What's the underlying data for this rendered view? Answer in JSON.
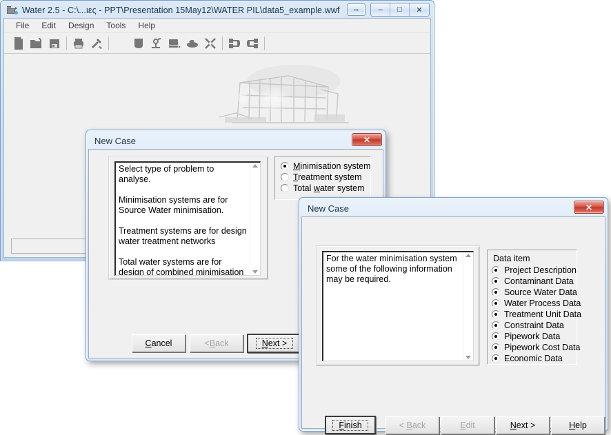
{
  "main_window": {
    "title": "Water 2.5 - C:\\...ιες - PPT\\Presentation 15May12\\WATER PIL\\data5_example.wwf",
    "app_icon_name": "water-app-icon",
    "window_buttons": [
      {
        "name": "restore-size-button",
        "glyph": "⇔"
      },
      {
        "name": "minimize-button",
        "glyph": "–"
      },
      {
        "name": "maximize-button",
        "glyph": "□"
      },
      {
        "name": "close-button",
        "glyph": "✕"
      }
    ],
    "menu": [
      {
        "name": "menu-file",
        "label": "File"
      },
      {
        "name": "menu-edit",
        "label": "Edit"
      },
      {
        "name": "menu-design",
        "label": "Design"
      },
      {
        "name": "menu-tools",
        "label": "Tools"
      },
      {
        "name": "menu-help",
        "label": "Help"
      }
    ],
    "toolbar": [
      {
        "name": "new-file-icon",
        "glyph": "▮"
      },
      {
        "name": "open-folder-icon",
        "glyph": "▰"
      },
      {
        "name": "save-disk-icon",
        "glyph": "▣"
      },
      {
        "sep": true
      },
      {
        "name": "print-icon",
        "glyph": "⎙"
      },
      {
        "name": "tools-hammer-icon",
        "glyph": "⚒"
      },
      {
        "sep": true
      },
      {
        "name": "c-to-f-convert-icon",
        "glyph": "C→F"
      },
      {
        "name": "vessel-icon",
        "glyph": "▼"
      },
      {
        "name": "pump-icon",
        "glyph": "⚒"
      },
      {
        "name": "process-unit-icon",
        "glyph": "▬"
      },
      {
        "name": "treatment-unit-icon",
        "glyph": "●"
      },
      {
        "name": "network-split-icon",
        "glyph": "✕"
      },
      {
        "sep": true
      },
      {
        "name": "layout-left-icon",
        "glyph": "⊞"
      },
      {
        "name": "layout-right-icon",
        "glyph": "⊟"
      },
      {
        "sep": true
      },
      {
        "name": "help-question-icon",
        "glyph": "?"
      }
    ],
    "status_text": ""
  },
  "dialog1": {
    "title": "New Case",
    "close_glyph": "✕",
    "description": "Select type of problem to analyse.\n\nMinimisation systems are for Source Water minimisation.\n\nTreatment systems are for design water treatment networks\n\nTotal water systems are for design of combined minimisation and treatment networks.",
    "options": [
      {
        "name": "radio-minimisation-system",
        "label_pre": "",
        "label_u": "M",
        "label_post": "inimisation system",
        "checked": true
      },
      {
        "name": "radio-treatment-system",
        "label_pre": "",
        "label_u": "T",
        "label_post": "reatment system",
        "checked": false
      },
      {
        "name": "radio-total-water-system",
        "label_pre": "Total ",
        "label_u": "w",
        "label_post": "ater system",
        "checked": false
      }
    ],
    "buttons": [
      {
        "name": "cancel-button",
        "pre": "",
        "u": "C",
        "post": "ancel",
        "state": "normal"
      },
      {
        "name": "back-button",
        "pre": "<",
        "u": "B",
        "post": "ack",
        "state": "disabled"
      },
      {
        "name": "next-button",
        "pre": "",
        "u": "N",
        "post": "ext >",
        "state": "default"
      }
    ]
  },
  "dialog2": {
    "title": "New Case",
    "close_glyph": "✕",
    "description": "For the water minimisation system some of the following information may be required.",
    "group_label": "Data item",
    "data_items": [
      {
        "name": "radio-project-description",
        "label": "Project Description",
        "checked": true
      },
      {
        "name": "radio-contaminant-data",
        "label": "Contaminant Data",
        "checked": true
      },
      {
        "name": "radio-source-water-data",
        "label": "Source Water Data",
        "checked": true
      },
      {
        "name": "radio-water-process-data",
        "label": "Water Process Data",
        "checked": true
      },
      {
        "name": "radio-treatment-unit-data",
        "label": "Treatment Unit Data",
        "checked": true
      },
      {
        "name": "radio-constraint-data",
        "label": "Constraint Data",
        "checked": true
      },
      {
        "name": "radio-pipework-data",
        "label": "Pipework Data",
        "checked": true
      },
      {
        "name": "radio-pipework-cost-data",
        "label": "Pipework Cost Data",
        "checked": true
      },
      {
        "name": "radio-economic-data",
        "label": "Economic Data",
        "checked": true
      }
    ],
    "buttons": [
      {
        "name": "finish-button",
        "pre": "",
        "u": "F",
        "post": "inish",
        "state": "default"
      },
      {
        "name": "back-button",
        "pre": "< ",
        "u": "B",
        "post": "ack",
        "state": "disabled"
      },
      {
        "name": "edit-button",
        "pre": "",
        "u": "E",
        "post": "dit",
        "state": "disabled"
      },
      {
        "name": "next-button",
        "pre": "",
        "u": "N",
        "post": "ext >",
        "state": "normal"
      },
      {
        "name": "help-button",
        "pre": "",
        "u": "H",
        "post": "elp",
        "state": "normal"
      }
    ]
  },
  "colors": {
    "titlebar_blue": "#cbe0f3",
    "dialog_face": "#f0f0f0",
    "close_red": "#c1392b",
    "accent_border": "#7aa5d2"
  }
}
